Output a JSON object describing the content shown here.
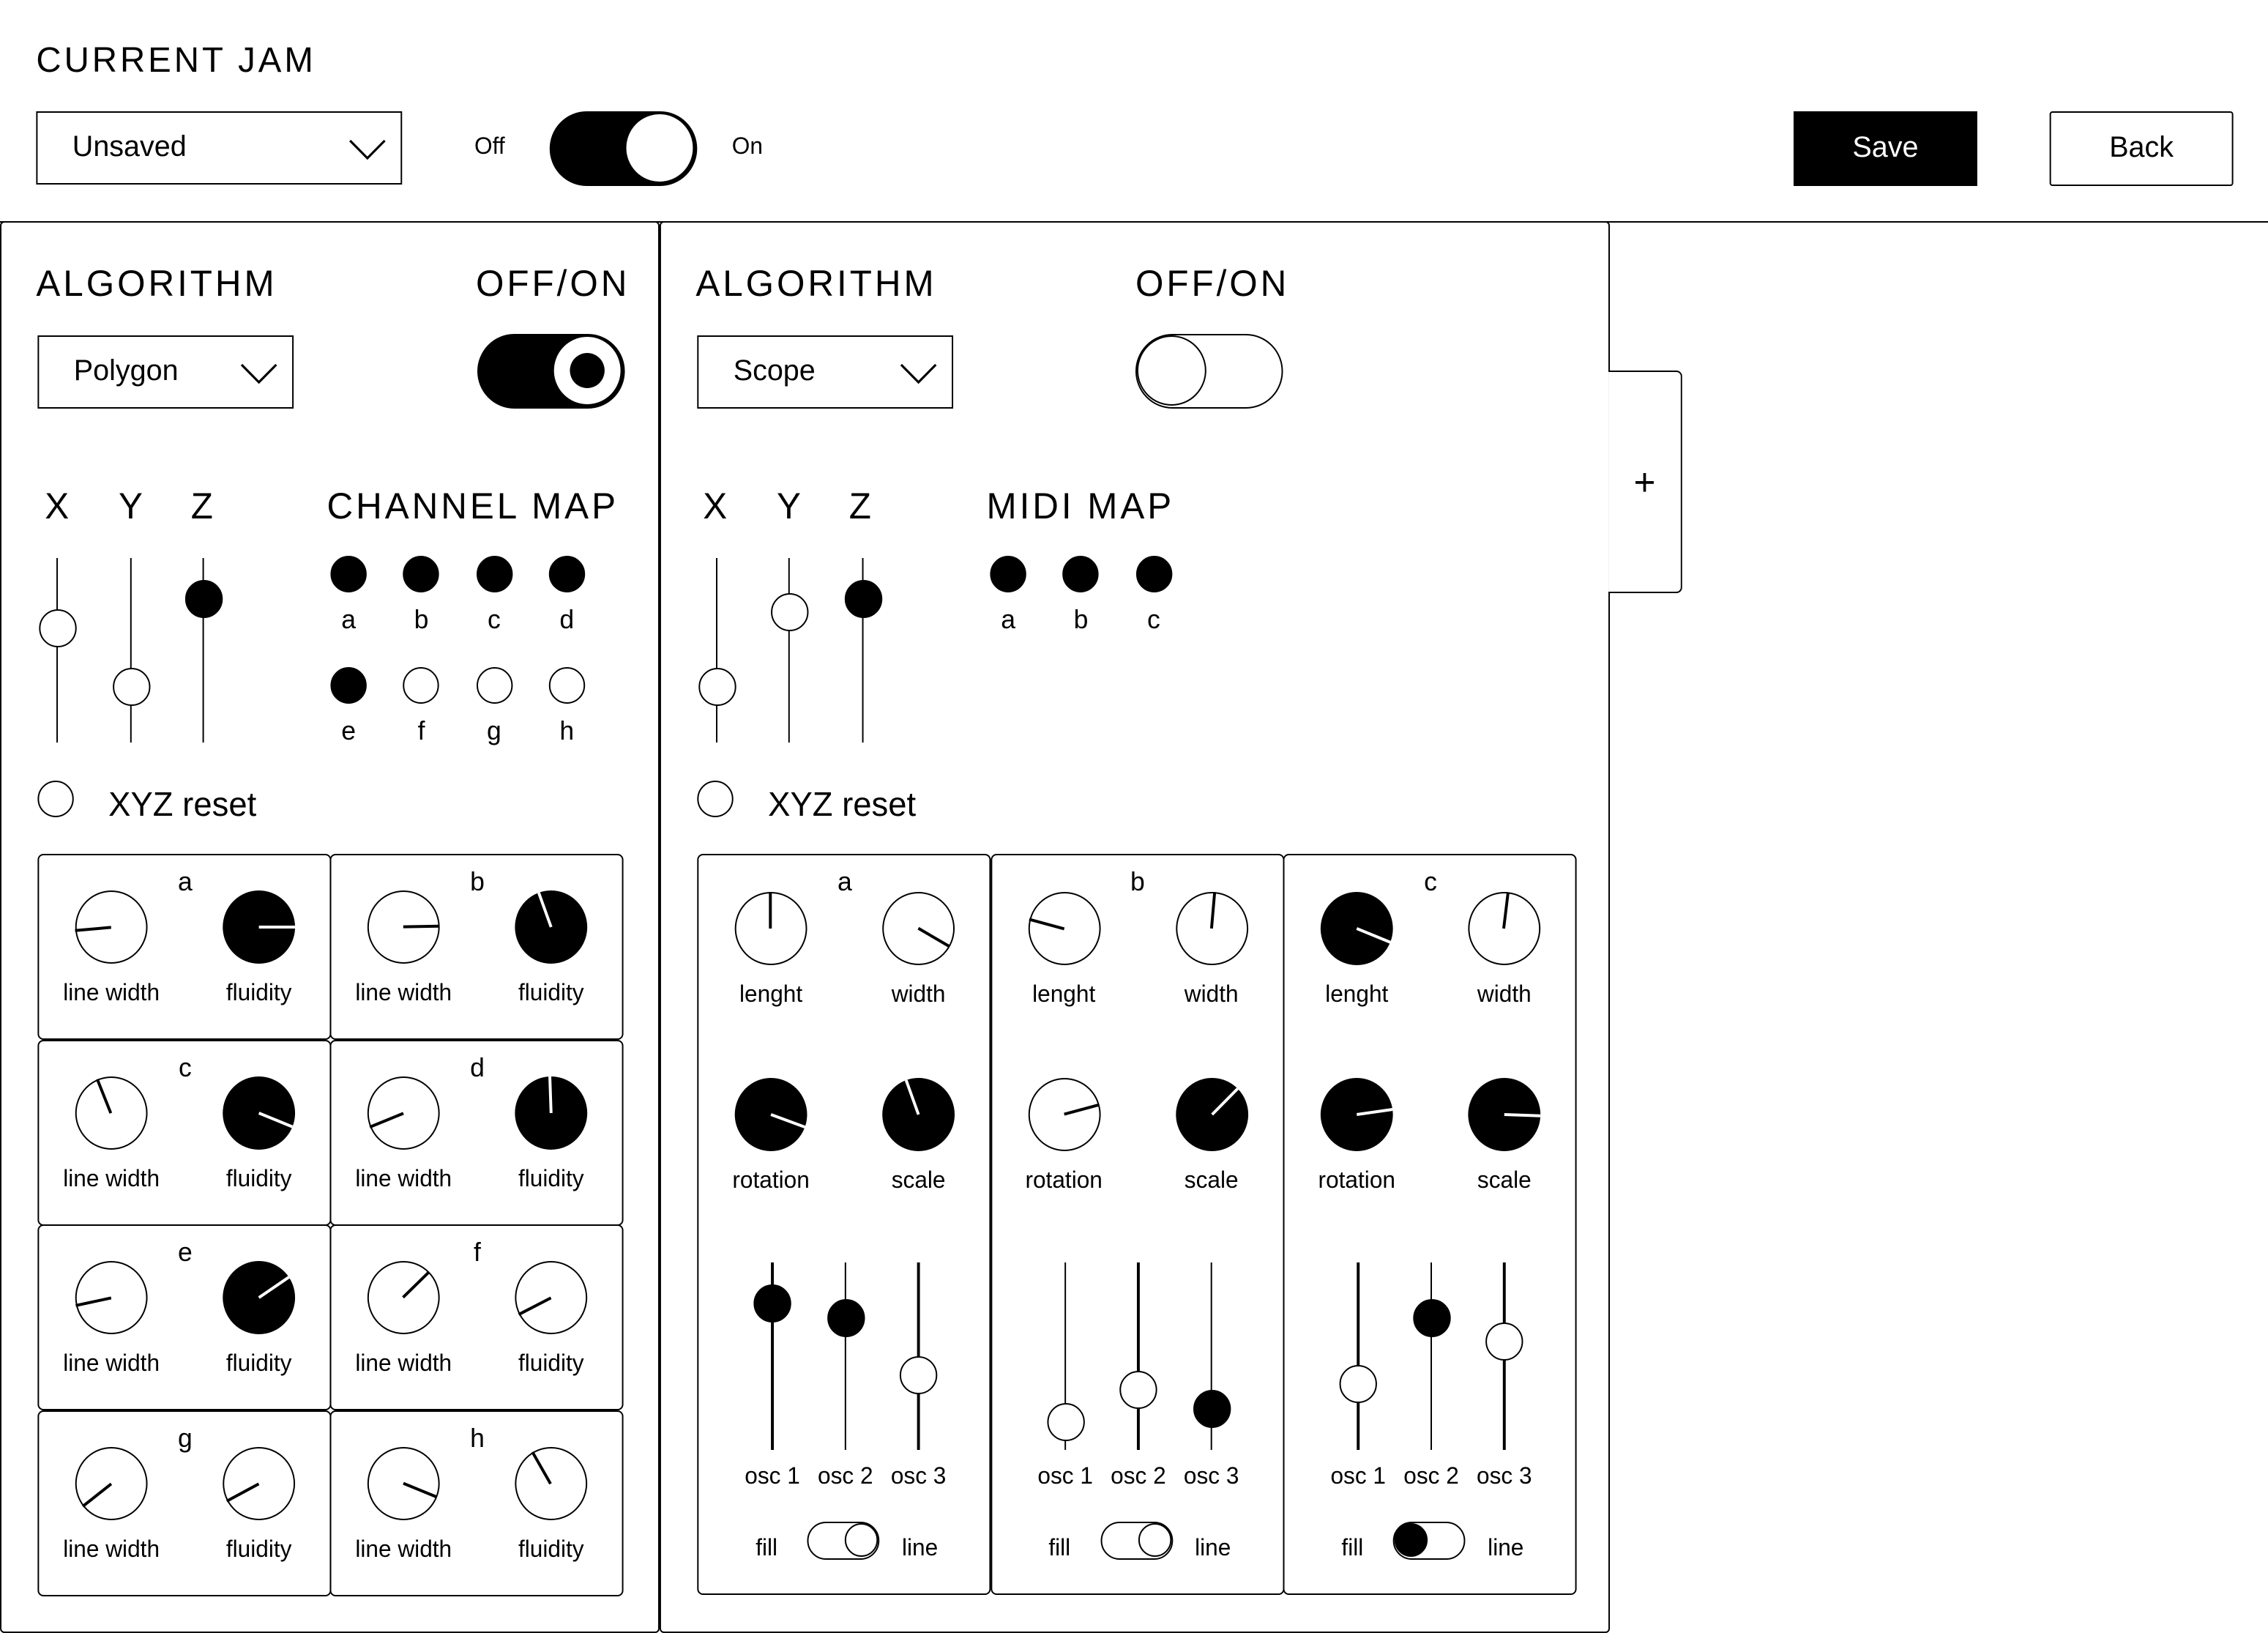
{
  "header": {
    "title": "CURRENT JAM",
    "preset_select": "Unsaved",
    "power_off_label": "Off",
    "power_on_label": "On",
    "power_on": true,
    "save_label": "Save",
    "back_label": "Back"
  },
  "add_panel_label": "+",
  "panels": [
    {
      "algorithm_label": "ALGORITHM",
      "algorithm_value": "Polygon",
      "offon_label": "OFF/ON",
      "enabled": true,
      "axes": {
        "x_label": "X",
        "y_label": "Y",
        "z_label": "Z",
        "x_value": 0.62,
        "y_value": 0.3,
        "z_value": 0.78
      },
      "map_title": "CHANNEL MAP",
      "channels": [
        {
          "label": "a",
          "active": true
        },
        {
          "label": "b",
          "active": true
        },
        {
          "label": "c",
          "active": true
        },
        {
          "label": "d",
          "active": true
        },
        {
          "label": "e",
          "active": true
        },
        {
          "label": "f",
          "active": false
        },
        {
          "label": "g",
          "active": false
        },
        {
          "label": "h",
          "active": false
        }
      ],
      "reset_label": "XYZ reset",
      "cells": [
        {
          "letter": "a",
          "line_width_label": "line width",
          "fluidity_label": "fluidity",
          "line_width_angle": -95,
          "fluidity_angle": 90
        },
        {
          "letter": "b",
          "line_width_label": "line width",
          "fluidity_label": "fluidity",
          "line_width_angle": 89,
          "fluidity_angle": -20
        },
        {
          "letter": "c",
          "line_width_label": "line width",
          "fluidity_label": "fluidity",
          "line_width_angle": -22,
          "fluidity_angle": 112
        },
        {
          "letter": "d",
          "line_width_label": "line width",
          "fluidity_label": "fluidity",
          "line_width_angle": -112,
          "fluidity_angle": -2
        },
        {
          "letter": "e",
          "line_width_label": "line width",
          "fluidity_label": "fluidity",
          "line_width_angle": -102,
          "fluidity_angle": 56
        },
        {
          "letter": "f",
          "line_width_label": "line width",
          "fluidity_label": "fluidity",
          "line_width_angle": 46,
          "fluidity_angle": -117
        },
        {
          "letter": "g",
          "line_width_label": "line width",
          "fluidity_label": "fluidity",
          "line_width_angle": -128,
          "fluidity_angle": -118
        },
        {
          "letter": "h",
          "line_width_label": "line width",
          "fluidity_label": "fluidity",
          "line_width_angle": 112,
          "fluidity_angle": -30
        }
      ]
    },
    {
      "algorithm_label": "ALGORITHM",
      "algorithm_value": "Scope",
      "offon_label": "OFF/ON",
      "enabled": false,
      "axes": {
        "x_label": "X",
        "y_label": "Y",
        "z_label": "Z",
        "x_value": 0.3,
        "y_value": 0.71,
        "z_value": 0.78
      },
      "map_title": "MIDI MAP",
      "channels": [
        {
          "label": "a",
          "active": true
        },
        {
          "label": "b",
          "active": true
        },
        {
          "label": "c",
          "active": true
        }
      ],
      "reset_label": "XYZ reset",
      "columns": [
        {
          "letter": "a",
          "knobs": [
            {
              "label": "lenght",
              "angle": 0,
              "filled": false
            },
            {
              "label": "width",
              "angle": 120,
              "filled": false
            },
            {
              "label": "rotation",
              "angle": 110,
              "filled": true
            },
            {
              "label": "scale",
              "angle": -20,
              "filled": true
            }
          ],
          "sliders": [
            {
              "label": "osc 1",
              "value": 0.78,
              "filled": true
            },
            {
              "label": "osc 2",
              "value": 0.7,
              "filled": true
            },
            {
              "label": "osc 3",
              "value": 0.4,
              "filled": false
            }
          ],
          "fill_label": "fill",
          "line_label": "line",
          "mode": "line"
        },
        {
          "letter": "b",
          "knobs": [
            {
              "label": "lenght",
              "angle": -75,
              "filled": false
            },
            {
              "label": "width",
              "angle": 5,
              "filled": false
            },
            {
              "label": "rotation",
              "angle": 75,
              "filled": false
            },
            {
              "label": "scale",
              "angle": 45,
              "filled": true
            }
          ],
          "sliders": [
            {
              "label": "osc 1",
              "value": 0.15,
              "filled": false
            },
            {
              "label": "osc 2",
              "value": 0.32,
              "filled": false
            },
            {
              "label": "osc 3",
              "value": 0.22,
              "filled": true
            }
          ],
          "fill_label": "fill",
          "line_label": "line",
          "mode": "line"
        },
        {
          "letter": "c",
          "knobs": [
            {
              "label": "lenght",
              "angle": 112,
              "filled": true
            },
            {
              "label": "width",
              "angle": 7,
              "filled": false
            },
            {
              "label": "rotation",
              "angle": 82,
              "filled": true
            },
            {
              "label": "scale",
              "angle": 92,
              "filled": true
            }
          ],
          "sliders": [
            {
              "label": "osc 1",
              "value": 0.35,
              "filled": false
            },
            {
              "label": "osc 2",
              "value": 0.7,
              "filled": true
            },
            {
              "label": "osc 3",
              "value": 0.58,
              "filled": false
            }
          ],
          "fill_label": "fill",
          "line_label": "line",
          "mode": "fill"
        }
      ]
    }
  ]
}
